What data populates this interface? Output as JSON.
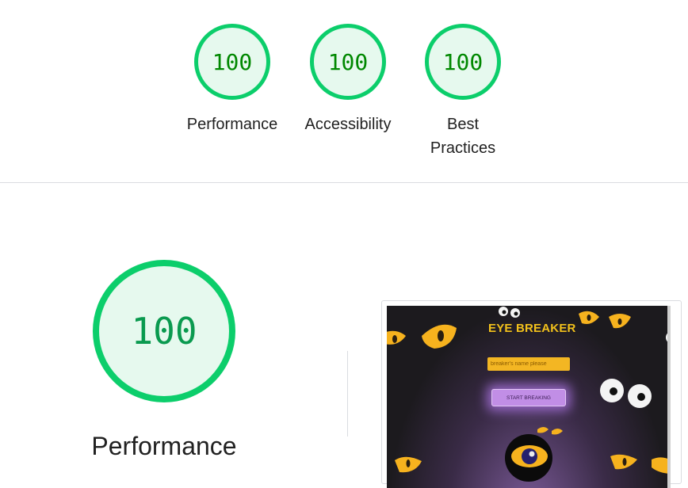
{
  "summary": {
    "gauges": [
      {
        "score": "100",
        "label": "Performance"
      },
      {
        "score": "100",
        "label": "Accessibility"
      },
      {
        "score": "100",
        "label": "Best Practices"
      }
    ]
  },
  "performance": {
    "score": "100",
    "label": "Performance",
    "score_color": "#0cce6b"
  },
  "screenshot": {
    "game_title": "EYE BREAKER",
    "name_placeholder": "breaker's name please",
    "start_button": "START BREAKING"
  },
  "colors": {
    "pass_green": "#0cce6b",
    "pass_fill": "#e6f9ee",
    "eye_yellow": "#f6b21e"
  }
}
